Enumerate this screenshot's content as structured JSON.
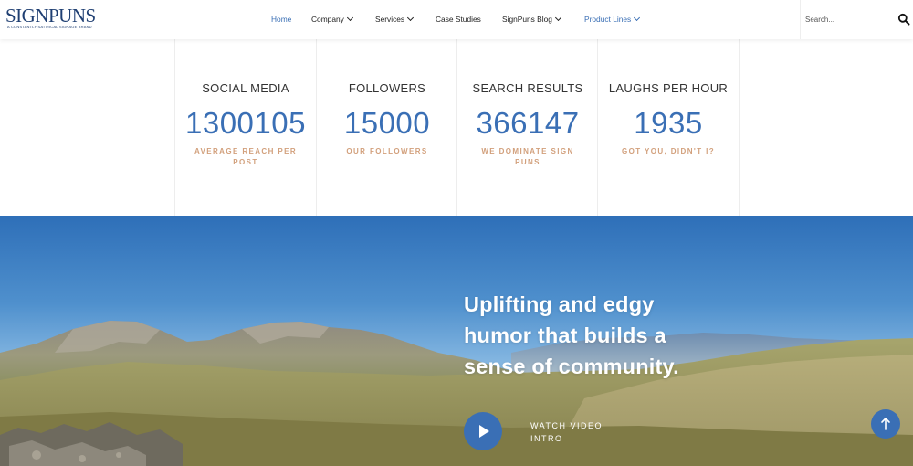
{
  "brand": {
    "logo_text": "SIGNPUNS",
    "logo_tagline": "A CONSTANTLY SATIRICAL SIGNAGE BRAND"
  },
  "nav": {
    "items": [
      {
        "label": "Home",
        "active": true,
        "dropdown": false
      },
      {
        "label": "Company",
        "active": false,
        "dropdown": true
      },
      {
        "label": "Services",
        "active": false,
        "dropdown": true
      },
      {
        "label": "Case Studies",
        "active": false,
        "dropdown": false
      },
      {
        "label": "SignPuns Blog",
        "active": false,
        "dropdown": true
      },
      {
        "label": "Product Lines",
        "active": false,
        "dropdown": true
      }
    ]
  },
  "search": {
    "placeholder": "Search...",
    "icon": "search-icon"
  },
  "stats": [
    {
      "title": "SOCIAL MEDIA",
      "number": "1300105",
      "subtitle": "AVERAGE REACH PER POST"
    },
    {
      "title": "FOLLOWERS",
      "number": "15000",
      "subtitle": "OUR FOLLOWERS"
    },
    {
      "title": "SEARCH RESULTS",
      "number": "366147",
      "subtitle": "WE DOMINATE SIGN PUNS"
    },
    {
      "title": "LAUGHS PER HOUR",
      "number": "1935",
      "subtitle": "GOT YOU, DIDN'T I?"
    }
  ],
  "hero": {
    "headline": "Uplifting and edgy humor that builds a sense of community.",
    "play_icon": "play-icon",
    "watch_label": "WATCH VIDEO INTRO"
  },
  "scroll_top": {
    "icon": "arrow-up-icon"
  },
  "colors": {
    "accent": "#3a6fb5",
    "subtitle": "#d2a07c",
    "logo": "#1f3f72"
  }
}
